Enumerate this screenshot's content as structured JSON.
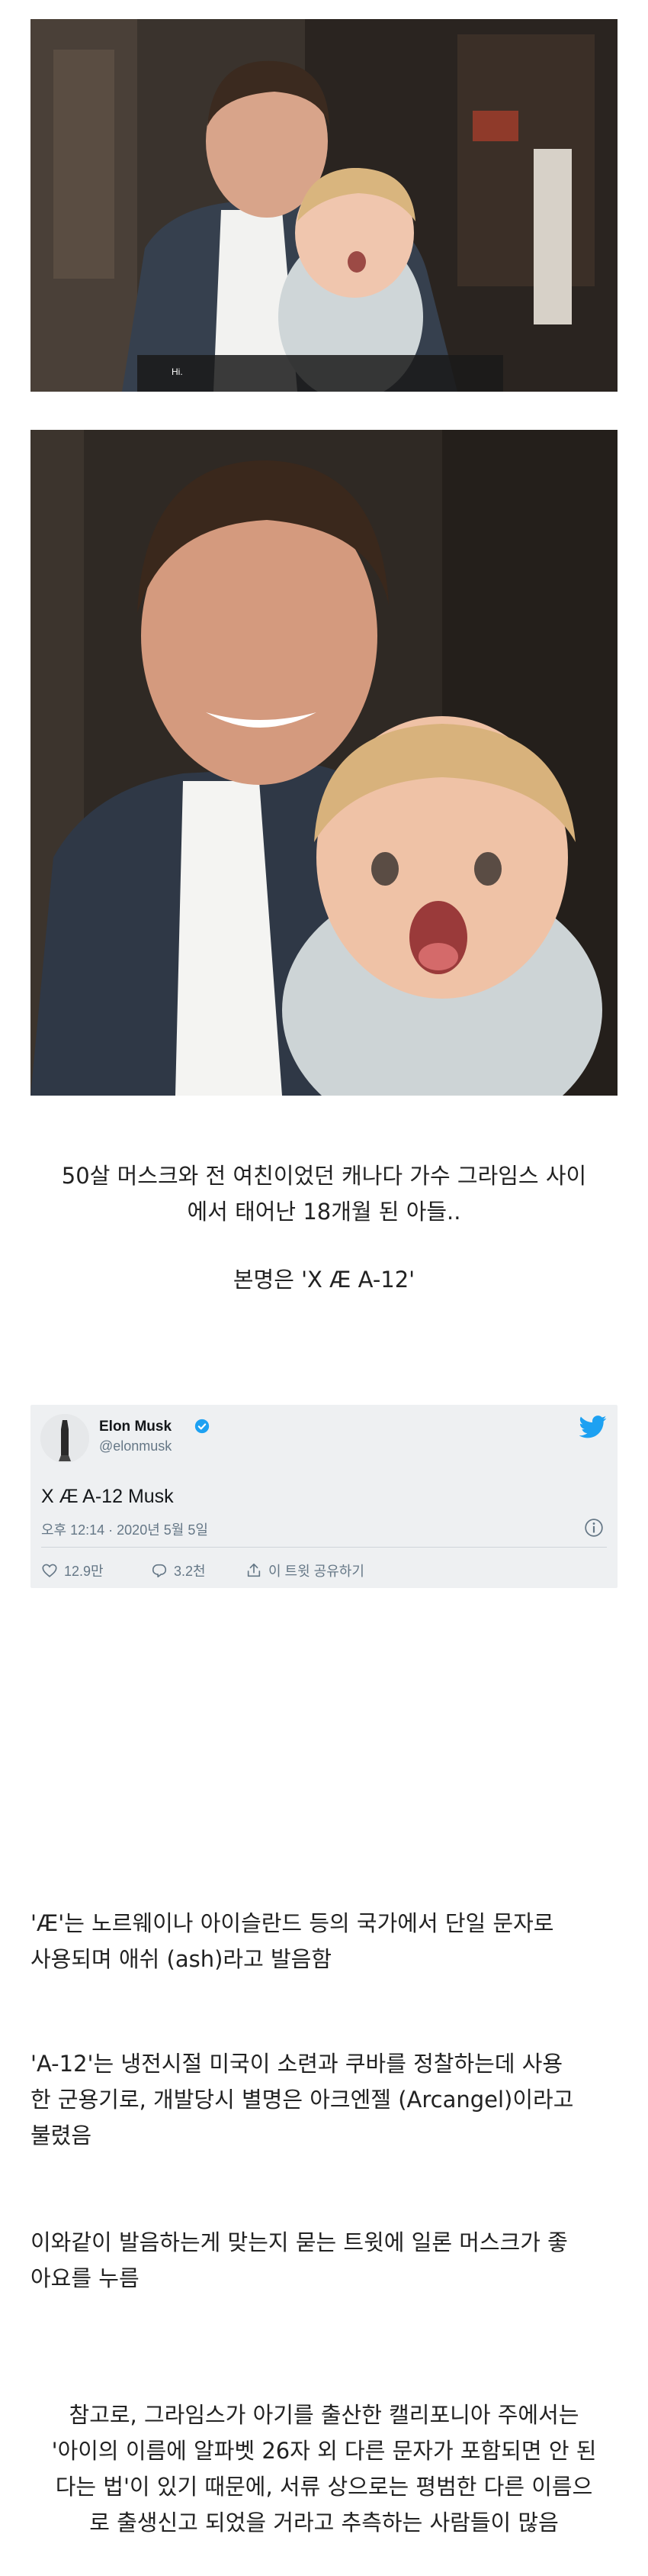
{
  "photo1": {
    "subtitle": "Hi."
  },
  "caption": {
    "line1": "50살 머스크와 전 여친이었던 캐나다 가수 그라임스 사이",
    "line2": "에서 태어난 18개월 된 아들..",
    "real_name": "본명은 'X Æ A-12'"
  },
  "tweet": {
    "name": "Elon Musk",
    "handle": "@elonmusk",
    "text": "X Æ A-12 Musk",
    "timestamp": "오후 12:14 · 2020년 5월 5일",
    "likes": "12.9만",
    "replies": "3.2천",
    "share_label": "이 트윗 공유하기",
    "verified_color": "#1da1f2",
    "bird_color": "#1da1f2",
    "icons": [
      "verified-badge-icon",
      "twitter-bird-icon",
      "info-icon",
      "heart-icon",
      "reply-icon",
      "share-icon"
    ]
  },
  "paragraphs": {
    "p1_line1": "'Æ'는 노르웨이나 아이슬란드 등의 국가에서 단일 문자로",
    "p1_line2": "사용되며 애쉬 (ash)라고 발음함",
    "p2_line1": "'A-12'는 냉전시절 미국이 소련과 쿠바를 정찰하는데 사용",
    "p2_line2": "한 군용기로, 개발당시 별명은 아크엔젤 (Arcangel)이라고",
    "p2_line3": "불렸음",
    "p3_line1": "이와같이 발음하는게 맞는지 묻는 트윗에 일론 머스크가 좋",
    "p3_line2": "아요를 누름",
    "p4_line1": "참고로, 그라임스가 아기를 출산한 캘리포니아 주에서는",
    "p4_line2": "'아이의 이름에 알파벳 26자 외 다른 문자가 포함되면 안 된",
    "p4_line3": "다는 법'이 있기 때문에, 서류 상으로는 평범한 다른 이름으",
    "p4_line4": "로 출생신고 되었을 거라고 추측하는 사람들이 많음"
  }
}
